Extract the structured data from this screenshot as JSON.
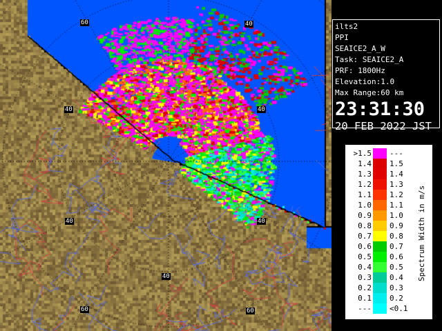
{
  "info": {
    "station": "ilts2",
    "product": "PPI",
    "scan": "SEAICE2_A_W",
    "task": "Task: SEAICE2_A",
    "prf": "PRF: 1800Hz",
    "elevation": "Elevation:1.0",
    "max_range": "Max Range:60 km",
    "time": "23:31:30",
    "date": "20 FEB 2022 JST"
  },
  "legend": {
    "title": "Spectrum Width in m/s",
    "rows": [
      {
        "lower": ">1.5",
        "upper": "---",
        "color": "#ff00ff"
      },
      {
        "lower": "1.4",
        "upper": "1.5",
        "color": "#dd0000"
      },
      {
        "lower": "1.3",
        "upper": "1.4",
        "color": "#e00000"
      },
      {
        "lower": "1.2",
        "upper": "1.3",
        "color": "#ee1100"
      },
      {
        "lower": "1.1",
        "upper": "1.2",
        "color": "#ff3300"
      },
      {
        "lower": "1.0",
        "upper": "1.1",
        "color": "#ff6600"
      },
      {
        "lower": "0.9",
        "upper": "1.0",
        "color": "#ff9900"
      },
      {
        "lower": "0.8",
        "upper": "0.9",
        "color": "#ffcc00"
      },
      {
        "lower": "0.7",
        "upper": "0.8",
        "color": "#ffff00"
      },
      {
        "lower": "0.6",
        "upper": "0.7",
        "color": "#00cc00"
      },
      {
        "lower": "0.5",
        "upper": "0.6",
        "color": "#00ee00"
      },
      {
        "lower": "0.4",
        "upper": "0.5",
        "color": "#33ff33"
      },
      {
        "lower": "0.3",
        "upper": "0.4",
        "color": "#00cc99"
      },
      {
        "lower": "0.2",
        "upper": "0.3",
        "color": "#00ddcc"
      },
      {
        "lower": "0.1",
        "upper": "0.2",
        "color": "#00eeee"
      },
      {
        "lower": "---",
        "upper": "<0.1",
        "color": "#00ffff"
      }
    ]
  },
  "map": {
    "range_ring_labels": [
      "60",
      "40",
      "40",
      "40",
      "40",
      "40",
      "40",
      "60",
      "60"
    ],
    "sea_color": "#0055ff",
    "land_color": "#7a6440",
    "coast_color": "#000000"
  }
}
